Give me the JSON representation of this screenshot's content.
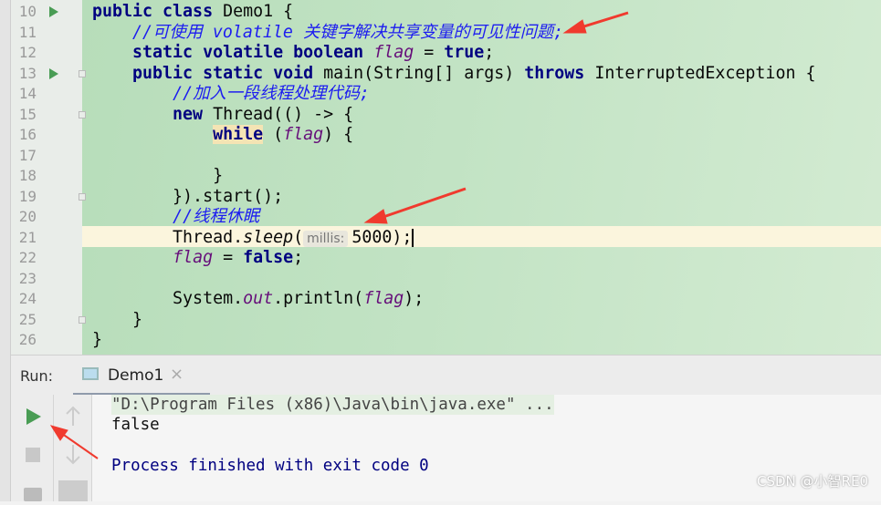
{
  "editor": {
    "line_numbers": [
      10,
      11,
      12,
      13,
      14,
      15,
      16,
      17,
      18,
      19,
      20,
      21,
      22,
      23,
      24,
      25,
      26
    ],
    "lines": [
      [
        {
          "t": "public class ",
          "c": "kw"
        },
        {
          "t": "Demo1 {",
          "c": ""
        }
      ],
      [
        {
          "t": "    ",
          "c": ""
        },
        {
          "t": "//可使用 volatile 关键字解决共享变量的可见性问题;",
          "c": "cm"
        }
      ],
      [
        {
          "t": "    static volatile boolean ",
          "c": "kw"
        },
        {
          "t": "flag",
          "c": "fld"
        },
        {
          "t": " = ",
          "c": ""
        },
        {
          "t": "true",
          "c": "kw"
        },
        {
          "t": ";",
          "c": ""
        }
      ],
      [
        {
          "t": "    public static void ",
          "c": "kw"
        },
        {
          "t": "main(String[] args) ",
          "c": ""
        },
        {
          "t": "throws ",
          "c": "kw"
        },
        {
          "t": "InterruptedException {",
          "c": ""
        }
      ],
      [
        {
          "t": "        ",
          "c": ""
        },
        {
          "t": "//加入一段线程处理代码;",
          "c": "cm"
        }
      ],
      [
        {
          "t": "        new ",
          "c": "kw"
        },
        {
          "t": "Thread(() -> {",
          "c": ""
        }
      ],
      [
        {
          "t": "            ",
          "c": ""
        },
        {
          "t": "while",
          "c": "kw whilebg"
        },
        {
          "t": " (",
          "c": ""
        },
        {
          "t": "flag",
          "c": "fld"
        },
        {
          "t": ") {",
          "c": ""
        }
      ],
      [],
      [
        {
          "t": "            }",
          "c": ""
        }
      ],
      [
        {
          "t": "        }).start();",
          "c": ""
        }
      ],
      [
        {
          "t": "        ",
          "c": ""
        },
        {
          "t": "//线程休眠",
          "c": "cm"
        }
      ],
      [
        {
          "t": "        Thread.",
          "c": ""
        },
        {
          "t": "sleep",
          "c": "st"
        },
        {
          "t": "(",
          "c": ""
        },
        {
          "t": "millis:",
          "c": "hint"
        },
        {
          "t": "5000);",
          "c": ""
        },
        {
          "t": "",
          "c": "caret"
        }
      ],
      [
        {
          "t": "        ",
          "c": ""
        },
        {
          "t": "flag",
          "c": "fld"
        },
        {
          "t": " = ",
          "c": ""
        },
        {
          "t": "false",
          "c": "kw"
        },
        {
          "t": ";",
          "c": ""
        }
      ],
      [],
      [
        {
          "t": "        System.",
          "c": ""
        },
        {
          "t": "out",
          "c": "fld"
        },
        {
          "t": ".println(",
          "c": ""
        },
        {
          "t": "flag",
          "c": "fld"
        },
        {
          "t": ");",
          "c": ""
        }
      ],
      [
        {
          "t": "    }",
          "c": ""
        }
      ],
      [
        {
          "t": "}",
          "c": ""
        }
      ]
    ]
  },
  "run_panel": {
    "label": "Run:",
    "tab": "Demo1",
    "close": "×"
  },
  "console": {
    "lines": [
      "\"D:\\Program Files (x86)\\Java\\bin\\java.exe\" ...",
      "false",
      "",
      "Process finished with exit code 0"
    ]
  },
  "watermark": "CSDN @小智RE0"
}
